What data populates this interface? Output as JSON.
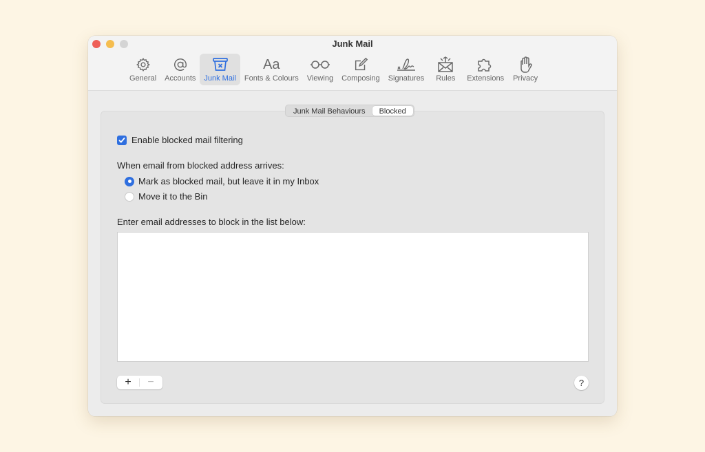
{
  "window": {
    "title": "Junk Mail"
  },
  "toolbar": {
    "items": [
      {
        "label": "General",
        "icon": "gear-icon"
      },
      {
        "label": "Accounts",
        "icon": "at-icon"
      },
      {
        "label": "Junk Mail",
        "icon": "junk-bin-icon",
        "active": true
      },
      {
        "label": "Fonts & Colours",
        "icon": "font-icon",
        "glyph": "Aa"
      },
      {
        "label": "Viewing",
        "icon": "glasses-icon"
      },
      {
        "label": "Composing",
        "icon": "compose-icon"
      },
      {
        "label": "Signatures",
        "icon": "signature-icon"
      },
      {
        "label": "Rules",
        "icon": "envelope-rules-icon"
      },
      {
        "label": "Extensions",
        "icon": "puzzle-icon"
      },
      {
        "label": "Privacy",
        "icon": "hand-icon"
      }
    ],
    "accent_color": "#2f6fdf"
  },
  "tabs": [
    {
      "label": "Junk Mail Behaviours",
      "selected": false
    },
    {
      "label": "Blocked",
      "selected": true
    }
  ],
  "blocked": {
    "enable_checkbox": {
      "label": "Enable blocked mail filtering",
      "checked": true
    },
    "arrival_label": "When email from blocked address arrives:",
    "options": [
      {
        "label": "Mark as blocked mail, but leave it in my Inbox",
        "selected": true
      },
      {
        "label": "Move it to the Bin",
        "selected": false
      }
    ],
    "list_label": "Enter email addresses to block in the list below:",
    "addresses": [],
    "add_label": "+",
    "remove_label": "−",
    "help_label": "?"
  }
}
